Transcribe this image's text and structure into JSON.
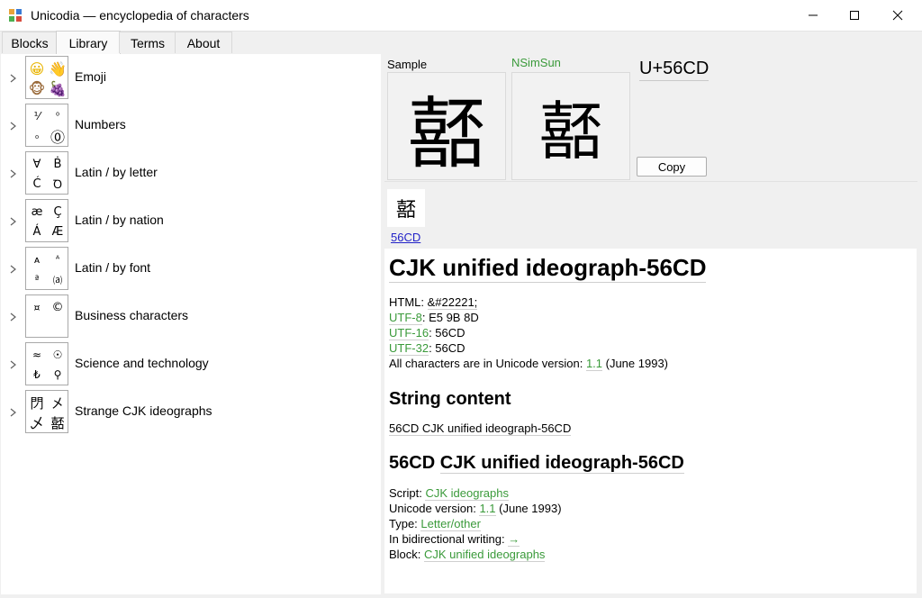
{
  "window": {
    "title": "Unicodia — encyclopedia of characters",
    "app_icon": "unicodia-logo-icon",
    "minimize_icon": "minimize-icon",
    "maximize_icon": "maximize-icon",
    "close_icon": "close-icon"
  },
  "tabs": [
    {
      "label": "Blocks",
      "active": false
    },
    {
      "label": "Library",
      "active": true
    },
    {
      "label": "Terms",
      "active": false
    },
    {
      "label": "About",
      "active": false
    }
  ],
  "library": [
    {
      "label": "Emoji",
      "glyphs": [
        "😀",
        "👋",
        "🐵",
        "🍇"
      ]
    },
    {
      "label": "Numbers",
      "glyphs": [
        "⅟",
        "⁰",
        "₀",
        "⓪"
      ]
    },
    {
      "label": "Latin / by letter",
      "glyphs": [
        "∀",
        "Ḃ",
        "Ć",
        "Ꝺ"
      ]
    },
    {
      "label": "Latin / by nation",
      "glyphs": [
        "æ",
        "Ç",
        "Á",
        "Æ"
      ]
    },
    {
      "label": "Latin / by font",
      "glyphs": [
        "ᴀ",
        "ᴬ",
        "ª",
        "⒜"
      ]
    },
    {
      "label": "Business characters",
      "glyphs": [
        "¤",
        "©",
        "",
        ""
      ]
    },
    {
      "label": "Science and technology",
      "glyphs": [
        "≈",
        "☉",
        "₺",
        "⚲"
      ]
    },
    {
      "label": "Strange CJK ideographs",
      "glyphs": [
        "閁",
        "㐅",
        "乄",
        "嚭"
      ]
    }
  ],
  "detail": {
    "sample_label": "Sample",
    "font_label": "NSimSun",
    "character": "嚭",
    "codepoint": "U+56CD",
    "copy_label": "Copy",
    "mini_code": "56CD",
    "name": "CJK unified ideograph-56CD",
    "html_label": "HTML: ",
    "html_value": "&#22221;",
    "utf8_label": "UTF-8",
    "utf8_value": ": E5 9B 8D",
    "utf16_label": "UTF-16",
    "utf16_value": ": 56CD",
    "utf32_label": "UTF-32",
    "utf32_value": ": 56CD",
    "version_line_prefix": "All characters are in Unicode version: ",
    "version_link": "1.1",
    "version_date": " (June 1993)",
    "string_content_heading": "String content",
    "string_content_value": "56CD CJK unified ideograph-56CD",
    "sub_heading_code": "56CD",
    "sub_heading_name": "CJK unified ideograph-56CD",
    "script_label": "Script: ",
    "script_value": "CJK ideographs",
    "uver_label": "Unicode version: ",
    "uver_link": "1.1",
    "uver_date": " (June 1993)",
    "type_label": "Type: ",
    "type_value": "Letter/other",
    "bidi_label": "In bidirectional writing: ",
    "bidi_value": "→",
    "block_label": "Block: ",
    "block_value": "CJK unified ideographs"
  }
}
